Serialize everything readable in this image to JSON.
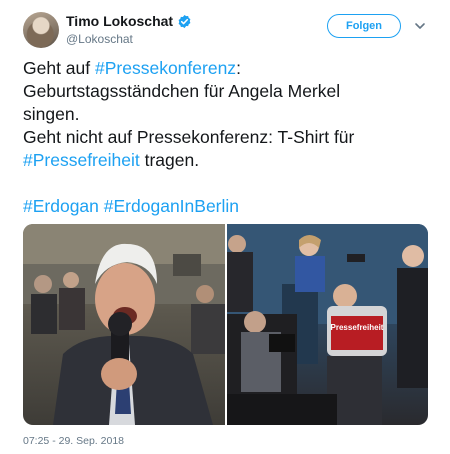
{
  "author": {
    "name": "Timo Lokoschat",
    "handle": "@Lokoschat",
    "verified": true
  },
  "follow_button": {
    "label": "Folgen"
  },
  "tweet": {
    "line1": {
      "prefix": "Geht auf ",
      "hashtag": "#Pressekonferenz",
      "suffix": ":"
    },
    "line2": "Geburtstagsständchen für Angela Merkel",
    "line3": "singen.",
    "line4": "Geht nicht auf Pressekonferenz: T-Shirt für",
    "line5": {
      "hashtag": "#Pressefreiheit",
      "suffix": " tragen."
    },
    "hashtags": [
      "#Erdogan",
      "#ErdoganInBerlin"
    ]
  },
  "media": {
    "photo2": {
      "shirt_text": "Pressefreiheit"
    }
  },
  "timestamp": "07:25 - 29. Sep. 2018",
  "colors": {
    "accent": "#1da1f2",
    "text": "#14171a",
    "secondary": "#657786"
  }
}
